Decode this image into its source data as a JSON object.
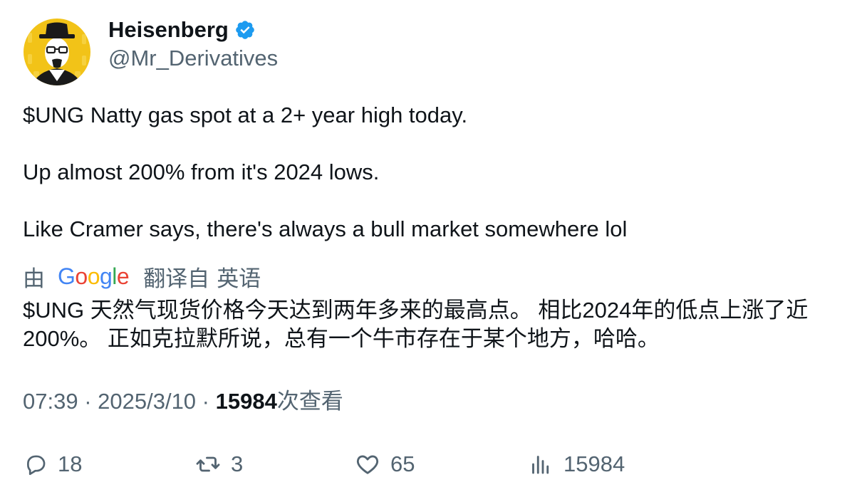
{
  "author": {
    "display_name": "Heisenberg",
    "handle": "@Mr_Derivatives",
    "verified": true,
    "verified_color": "#1d9bf0",
    "avatar_icon": "heisenberg-avatar-icon",
    "avatar_background": "#f2c318"
  },
  "tweet": {
    "lines": [
      "$UNG Natty gas spot at a 2+ year high today.",
      "Up almost 200% from it's 2024 lows.",
      "Like Cramer says, there's always a bull market somewhere lol"
    ]
  },
  "translation": {
    "by_label": "由",
    "provider": "Google",
    "provider_letters": [
      {
        "char": "G",
        "color": "#4285f4"
      },
      {
        "char": "o",
        "color": "#ea4335"
      },
      {
        "char": "o",
        "color": "#fbbc05"
      },
      {
        "char": "g",
        "color": "#4285f4"
      },
      {
        "char": "l",
        "color": "#34a853"
      },
      {
        "char": "e",
        "color": "#ea4335"
      }
    ],
    "translated_from_label": "翻译自",
    "source_language": "英语",
    "text": "$UNG 天然气现货价格今天达到两年多来的最高点。 相比2024年的低点上涨了近200%。 正如克拉默所说，总有一个牛市存在于某个地方，哈哈。"
  },
  "meta": {
    "time": "07:39",
    "separator": " · ",
    "date": "2025/3/10",
    "views_count": "15984",
    "views_label": "次查看"
  },
  "actions": {
    "reply": {
      "icon": "reply-icon",
      "count": "18"
    },
    "retweet": {
      "icon": "retweet-icon",
      "count": "3"
    },
    "like": {
      "icon": "heart-icon",
      "count": "65"
    },
    "views": {
      "icon": "views-chart-icon",
      "count": "15984"
    }
  },
  "colors": {
    "text_primary": "#0f1419",
    "text_secondary": "#536471"
  }
}
